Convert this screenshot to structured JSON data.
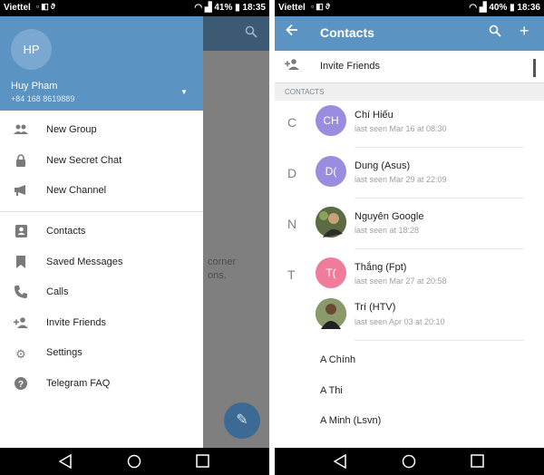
{
  "left_screen": {
    "status": {
      "carrier": "Viettel",
      "battery": "41%",
      "time": "18:35"
    },
    "behind_text": [
      "corner",
      "ons."
    ],
    "drawer": {
      "avatar_initials": "HP",
      "user_name": "Huy Pham",
      "user_phone": "+84 168 8619889",
      "avatar_color": "#7aa8d1",
      "header_color": "#5b93c3",
      "menu": [
        {
          "label": "New Group",
          "icon": "group-icon"
        },
        {
          "label": "New Secret Chat",
          "icon": "lock-icon"
        },
        {
          "label": "New Channel",
          "icon": "megaphone-icon"
        },
        {
          "label": "Contacts",
          "icon": "contacts-icon"
        },
        {
          "label": "Saved Messages",
          "icon": "bookmark-icon"
        },
        {
          "label": "Calls",
          "icon": "phone-icon"
        },
        {
          "label": "Invite Friends",
          "icon": "add-person-icon"
        },
        {
          "label": "Settings",
          "icon": "gear-icon"
        },
        {
          "label": "Telegram FAQ",
          "icon": "help-icon"
        }
      ]
    }
  },
  "right_screen": {
    "status": {
      "carrier": "Viettel",
      "battery": "40%",
      "time": "18:36"
    },
    "title": "Contacts",
    "invite_label": "Invite Friends",
    "section_header": "CONTACTS",
    "contacts": [
      {
        "letter": "C",
        "initials": "CH",
        "name": "Chí Hiếu",
        "last_seen": "last seen Mar 16 at 08:30",
        "color": "#9a8de0"
      },
      {
        "letter": "D",
        "initials": "D(",
        "name": "Dung (Asus)",
        "last_seen": "last seen Mar 29 at 22:09",
        "color": "#9a8de0"
      },
      {
        "letter": "N",
        "initials": "",
        "name": "Nguyên Google",
        "last_seen": "last seen at 18:28",
        "color": "#4a5a3a"
      },
      {
        "letter": "T",
        "initials": "T(",
        "name": "Thắng (Fpt)",
        "last_seen": "last seen Mar 27 at 20:58",
        "color": "#f07c9c"
      },
      {
        "letter": "",
        "initials": "",
        "name": "Trí (HTV)",
        "last_seen": "last seen Apr 03 at 20:10",
        "color": "#4a5a3a"
      }
    ],
    "phone_contacts": [
      "A Chính",
      "A Thi",
      "A Minh (Lsvn)"
    ]
  },
  "colors": {
    "accent": "#5b93c3",
    "dark_accent": "#3d5a75",
    "fab": "#3b6b94"
  }
}
